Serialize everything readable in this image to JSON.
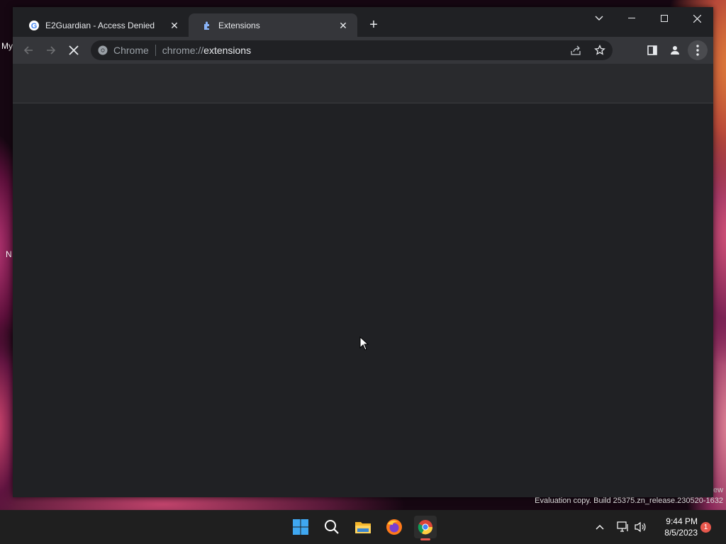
{
  "desktop": {
    "icon_labels": [
      "My",
      "N"
    ],
    "watermark_partial": "ew",
    "watermark": "Evaluation copy. Build 25375.zn_release.230520-1632"
  },
  "browser": {
    "tabs": [
      {
        "title": "E2Guardian - Access Denied",
        "favicon": "google-icon",
        "active": false
      },
      {
        "title": "Extensions",
        "favicon": "extensions-puzzle-icon",
        "active": true
      }
    ],
    "omnibox": {
      "chip_label": "Chrome",
      "url_prefix": "chrome://",
      "url_path": "extensions"
    },
    "loading": true
  },
  "taskbar": {
    "apps": [
      "start-windows-icon",
      "search-icon",
      "file-explorer-icon",
      "firefox-icon",
      "chrome-icon"
    ],
    "clock_time": "9:44 PM",
    "clock_date": "8/5/2023",
    "notification_count": "1"
  },
  "colors": {
    "window_bg": "#202124",
    "toolbar_bg": "#35363a",
    "text": "#e8eaed",
    "accent_red": "#e8584d"
  }
}
